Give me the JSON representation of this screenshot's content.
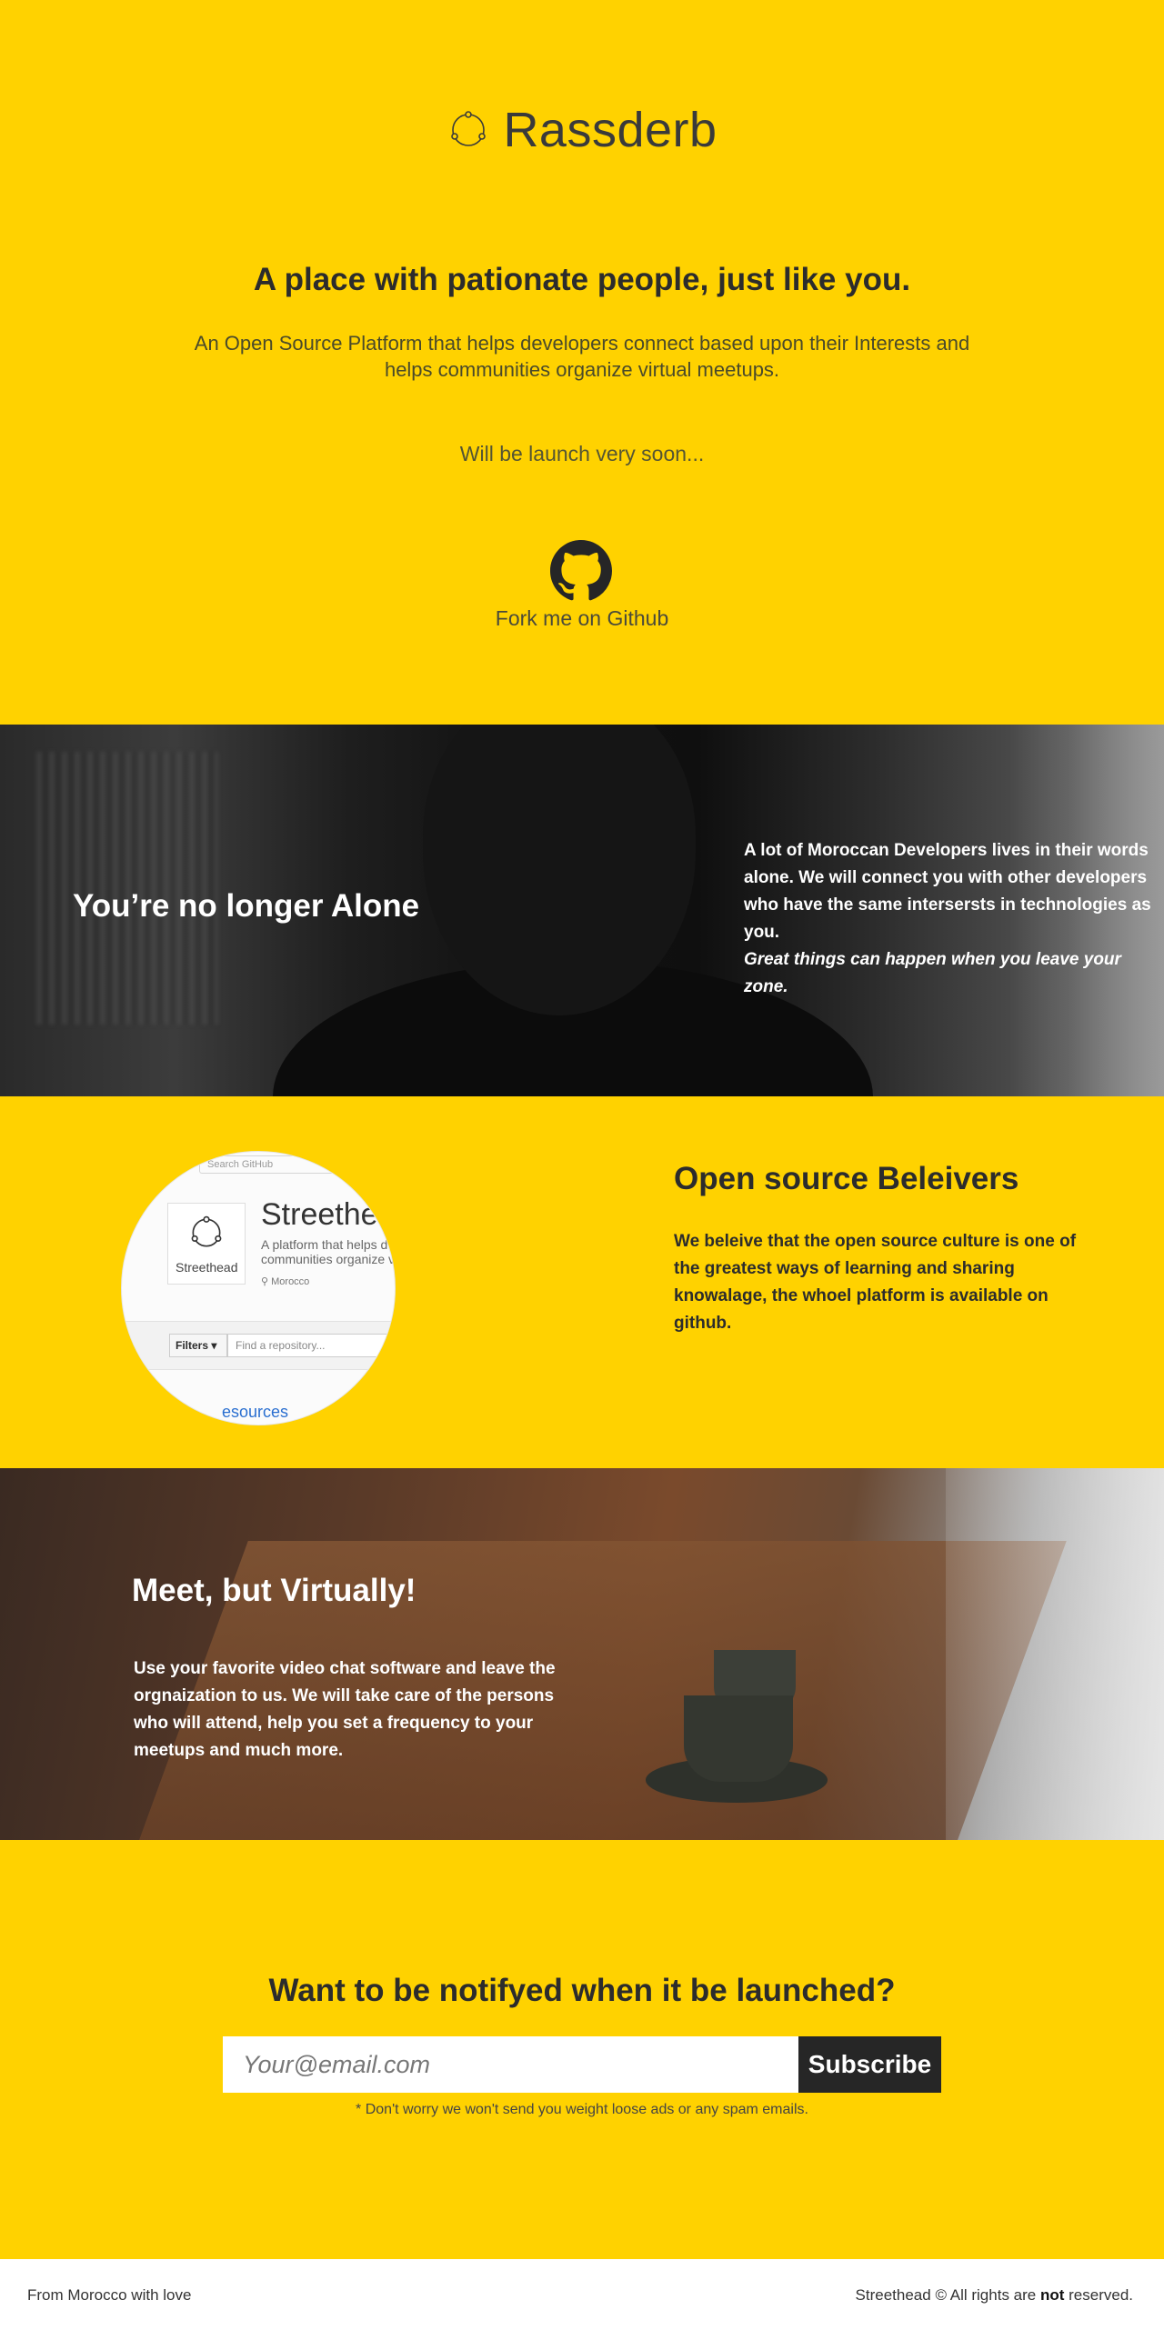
{
  "hero": {
    "brand": "Rassderb",
    "logo_icon": "network-circle-icon",
    "title": "A place with pationate people, just like you.",
    "description": "An Open Source Platform that helps developers connect based upon their Interests and helps communities organize virtual meetups.",
    "launch": "Will be launch very soon...",
    "github_icon": "github-octocat-icon",
    "github_link": "Fork me on Github"
  },
  "alone": {
    "title": "You’re no longer Alone",
    "text": "A lot of Moroccan Developers lives in their words alone. We will connect you with other developers who have the same intersersts in technologies as you.",
    "tagline": "Great things can happen when you leave your zone."
  },
  "open_source": {
    "title": "Open source Beleivers",
    "text": "We beleive that the open source culture is one of the greatest ways of learning and sharing knowalage, the whoel platform is available on github.",
    "screenshot": {
      "search_placeholder": "Search GitHub",
      "org_name": "Streethead",
      "avatar_label": "Streethead",
      "org_desc_line1": "A platform that helps de",
      "org_desc_line2": "communities organize vi",
      "location": "Morocco",
      "filters_label": "Filters ▾",
      "find_placeholder": "Find a repository...",
      "resources_label": "esources"
    }
  },
  "meet": {
    "title": "Meet, but Virtually!",
    "text": "Use your favorite video chat software and leave the orgnaization to us. We will take care of the persons who will attend, help you set a frequency to your\n meetups and much more."
  },
  "subscribe": {
    "title": "Want to be notifyed when it be launched?",
    "placeholder": "Your@email.com",
    "button": "Subscribe",
    "note": "* Don't worry we won't send you weight loose ads or any spam emails."
  },
  "footer": {
    "left": "From Morocco with love",
    "right_prefix": "Streethead © All rights are ",
    "right_bold": "not",
    "right_suffix": " reserved."
  },
  "colors": {
    "accent": "#ffd200",
    "dark": "#262626"
  }
}
